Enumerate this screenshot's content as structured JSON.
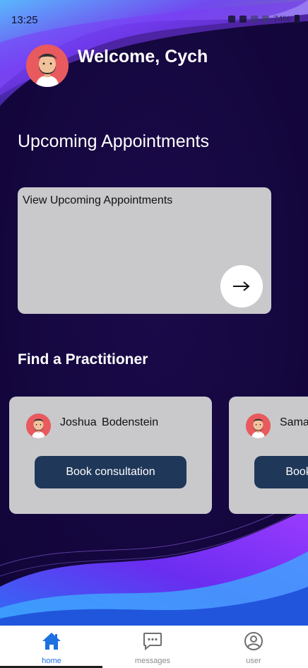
{
  "status_bar": {
    "time": "13:25",
    "battery": "74%"
  },
  "header": {
    "welcome": "Welcome, Cych"
  },
  "appointments": {
    "section_title": "Upcoming Appointments",
    "card_label": "View Upcoming Appointments",
    "arrow": "→"
  },
  "practitioners": {
    "section_title": "Find a Practitioner",
    "items": [
      {
        "name": "Joshua Bodenstein",
        "button_label": "Book consultation"
      },
      {
        "name": "Sama",
        "button_label": "Book consultation"
      }
    ]
  },
  "bottom_nav": {
    "items": [
      {
        "label": "home",
        "icon": "home-icon",
        "active": true
      },
      {
        "label": "messages",
        "icon": "chat-bubble-icon",
        "active": false
      },
      {
        "label": "user",
        "icon": "user-circle-icon",
        "active": false
      }
    ]
  },
  "colors": {
    "background": "#16073f",
    "card": "#c9c9cc",
    "button": "#1f3759",
    "active_nav": "#1e6fe0",
    "avatar_bg": "#e85a5e"
  }
}
